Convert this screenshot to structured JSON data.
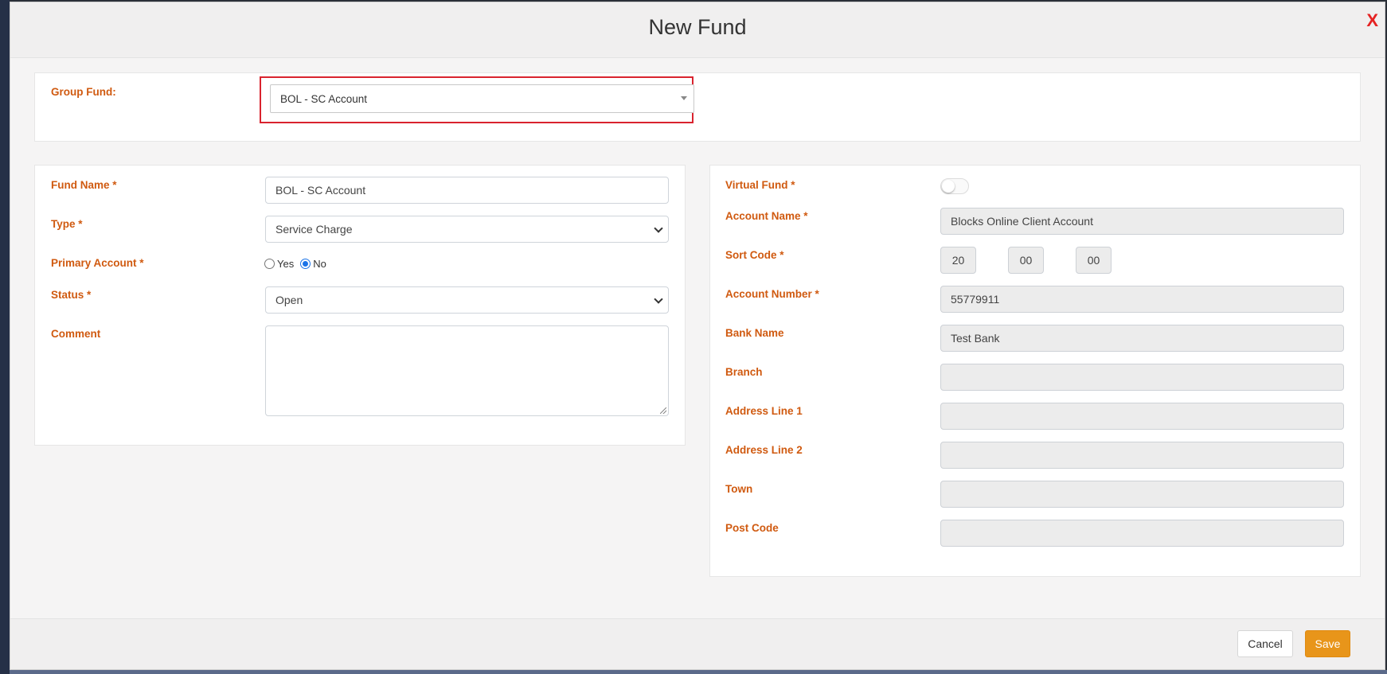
{
  "modal": {
    "title": "New Fund",
    "close_label": "X"
  },
  "group_fund": {
    "label": "Group Fund:",
    "value": "BOL - SC Account"
  },
  "left_form": {
    "fund_name": {
      "label": "Fund Name *",
      "value": "BOL - SC Account"
    },
    "type": {
      "label": "Type *",
      "value": "Service Charge"
    },
    "primary_account": {
      "label": "Primary Account *",
      "options": [
        "Yes",
        "No"
      ],
      "selected": "No"
    },
    "status": {
      "label": "Status *",
      "value": "Open"
    },
    "comment": {
      "label": "Comment",
      "value": ""
    }
  },
  "right_form": {
    "virtual_fund": {
      "label": "Virtual Fund *",
      "enabled": false
    },
    "account_name": {
      "label": "Account Name *",
      "value": "Blocks Online Client Account"
    },
    "sort_code": {
      "label": "Sort Code *",
      "parts": [
        "20",
        "00",
        "00"
      ]
    },
    "account_number": {
      "label": "Account Number *",
      "value": "55779911"
    },
    "bank_name": {
      "label": "Bank Name",
      "value": "Test Bank"
    },
    "branch": {
      "label": "Branch",
      "value": ""
    },
    "address_line_1": {
      "label": "Address Line 1",
      "value": ""
    },
    "address_line_2": {
      "label": "Address Line 2",
      "value": ""
    },
    "town": {
      "label": "Town",
      "value": ""
    },
    "post_code": {
      "label": "Post Code",
      "value": ""
    }
  },
  "footer": {
    "cancel_label": "Cancel",
    "save_label": "Save"
  },
  "colors": {
    "label": "#d05a10",
    "save_button": "#e8951a",
    "close": "#e52222",
    "highlight": "#d9232e"
  }
}
